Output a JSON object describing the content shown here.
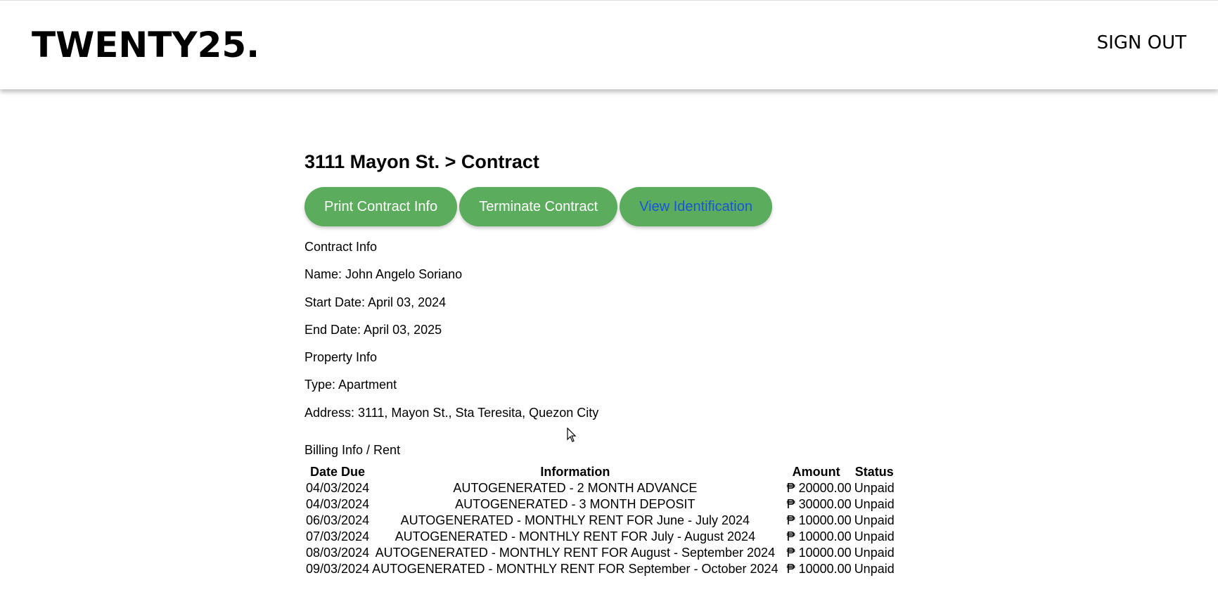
{
  "header": {
    "logo": "TWENTY25.",
    "sign_out": "SIGN OUT"
  },
  "page": {
    "title": "3111 Mayon St. > Contract"
  },
  "actions": {
    "print": "Print Contract Info",
    "terminate": "Terminate Contract",
    "view_id": "View Identification"
  },
  "contract_info": {
    "heading": "Contract Info",
    "name": "Name: John Angelo Soriano",
    "start": "Start Date: April 03, 2024",
    "end": "End Date: April 03, 2025"
  },
  "property_info": {
    "heading": "Property Info",
    "type": "Type: Apartment",
    "address": "Address: 3111, Mayon St., Sta Teresita, Quezon City"
  },
  "billing": {
    "heading": "Billing Info / Rent",
    "columns": [
      "Date Due",
      "Information",
      "Amount",
      "Status"
    ],
    "rows": [
      {
        "date": "04/03/2024",
        "info": "AUTOGENERATED - 2 MONTH ADVANCE",
        "amount": "₱ 20000.00",
        "status": "Unpaid"
      },
      {
        "date": "04/03/2024",
        "info": "AUTOGENERATED - 3 MONTH DEPOSIT",
        "amount": "₱ 30000.00",
        "status": "Unpaid"
      },
      {
        "date": "06/03/2024",
        "info": "AUTOGENERATED - MONTHLY RENT FOR June - July 2024",
        "amount": "₱ 10000.00",
        "status": "Unpaid"
      },
      {
        "date": "07/03/2024",
        "info": "AUTOGENERATED - MONTHLY RENT FOR July - August 2024",
        "amount": "₱ 10000.00",
        "status": "Unpaid"
      },
      {
        "date": "08/03/2024",
        "info": "AUTOGENERATED - MONTHLY RENT FOR August - September 2024",
        "amount": "₱ 10000.00",
        "status": "Unpaid"
      },
      {
        "date": "09/03/2024",
        "info": "AUTOGENERATED - MONTHLY RENT FOR September - October 2024",
        "amount": "₱ 10000.00",
        "status": "Unpaid"
      }
    ]
  },
  "colors": {
    "button_bg": "#5cac5e",
    "button_text": "#ffffff",
    "link_text": "#1a55d6"
  }
}
